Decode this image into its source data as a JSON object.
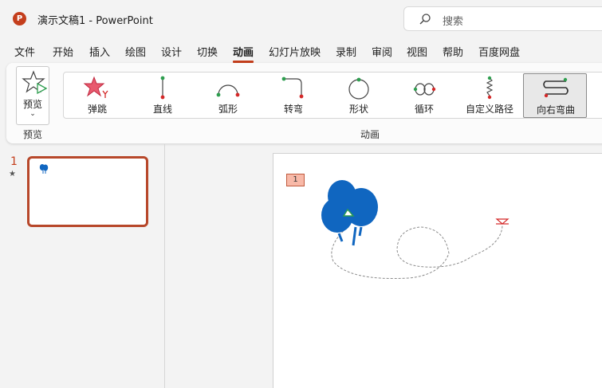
{
  "titlebar": {
    "app_logo": "P",
    "title": "演示文稿1  -  PowerPoint",
    "search_placeholder": "搜索"
  },
  "menu": {
    "tabs": [
      "文件",
      "开始",
      "插入",
      "绘图",
      "设计",
      "切换",
      "动画",
      "幻灯片放映",
      "录制",
      "审阅",
      "视图",
      "帮助",
      "百度网盘"
    ],
    "active": "动画"
  },
  "ribbon": {
    "preview_button_label": "预览",
    "preview_group_label": "预览",
    "animation_group_label": "动画",
    "animations": [
      {
        "label": "弹跳",
        "icon": "bounce-star-icon"
      },
      {
        "label": "直线",
        "icon": "line-path-icon"
      },
      {
        "label": "弧形",
        "icon": "arc-path-icon"
      },
      {
        "label": "转弯",
        "icon": "turn-path-icon"
      },
      {
        "label": "形状",
        "icon": "shape-path-icon"
      },
      {
        "label": "循环",
        "icon": "loop-path-icon"
      },
      {
        "label": "自定义路径",
        "icon": "custom-path-icon"
      },
      {
        "label": "向右弯曲",
        "icon": "curvy-right-icon",
        "selected": true
      }
    ]
  },
  "thumbnails": {
    "slide_number": "1",
    "animation_marker": "★"
  },
  "slide": {
    "animation_tag": "1"
  },
  "colors": {
    "accent": "#c43e1c",
    "balloon": "#1066c0",
    "path_start": "#2e9e4f",
    "path_end": "#d42828"
  }
}
